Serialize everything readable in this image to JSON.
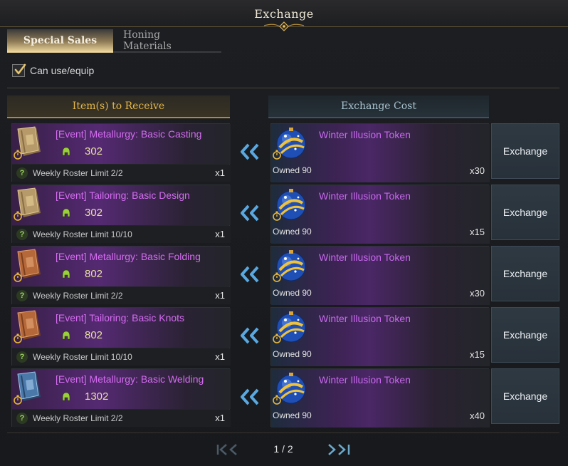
{
  "window": {
    "title": "Exchange"
  },
  "tabs": [
    {
      "label": "Special Sales",
      "active": true
    },
    {
      "label": "Honing Materials",
      "active": false
    }
  ],
  "filter": {
    "label": "Can use/equip",
    "checked": true
  },
  "headers": {
    "receive": "Item(s) to Receive",
    "cost": "Exchange Cost"
  },
  "rows": [
    {
      "item_name": "[Event] Metallurgy: Basic Casting",
      "item_level": "302",
      "limit": "Weekly Roster Limit 2/2",
      "item_qty": "x1",
      "token_name": "Winter Illusion Token",
      "owned": "Owned 90",
      "cost_qty": "x30",
      "button": "Exchange",
      "book_icon": "tan-book-icon"
    },
    {
      "item_name": "[Event] Tailoring: Basic Design",
      "item_level": "302",
      "limit": "Weekly Roster Limit 10/10",
      "item_qty": "x1",
      "token_name": "Winter Illusion Token",
      "owned": "Owned 90",
      "cost_qty": "x15",
      "button": "Exchange",
      "book_icon": "tan-book-icon"
    },
    {
      "item_name": "[Event] Metallurgy: Basic Folding",
      "item_level": "802",
      "limit": "Weekly Roster Limit 2/2",
      "item_qty": "x1",
      "token_name": "Winter Illusion Token",
      "owned": "Owned 90",
      "cost_qty": "x30",
      "button": "Exchange",
      "book_icon": "brown-book-icon"
    },
    {
      "item_name": "[Event] Tailoring: Basic Knots",
      "item_level": "802",
      "limit": "Weekly Roster Limit 10/10",
      "item_qty": "x1",
      "token_name": "Winter Illusion Token",
      "owned": "Owned 90",
      "cost_qty": "x15",
      "button": "Exchange",
      "book_icon": "brown-book-icon"
    },
    {
      "item_name": "[Event] Metallurgy: Basic Welding",
      "item_level": "1302",
      "limit": "Weekly Roster Limit 2/2",
      "item_qty": "x1",
      "token_name": "Winter Illusion Token",
      "owned": "Owned 90",
      "cost_qty": "x40",
      "button": "Exchange",
      "book_icon": "blue-book-icon"
    }
  ],
  "pagination": {
    "text": "1 / 2"
  },
  "colors": {
    "item_name": "#d46cf0",
    "token_name": "#c868ee",
    "receive_header": "#e3b64a",
    "cost_header": "#a9c3cf",
    "level": "#e7e0a3"
  }
}
